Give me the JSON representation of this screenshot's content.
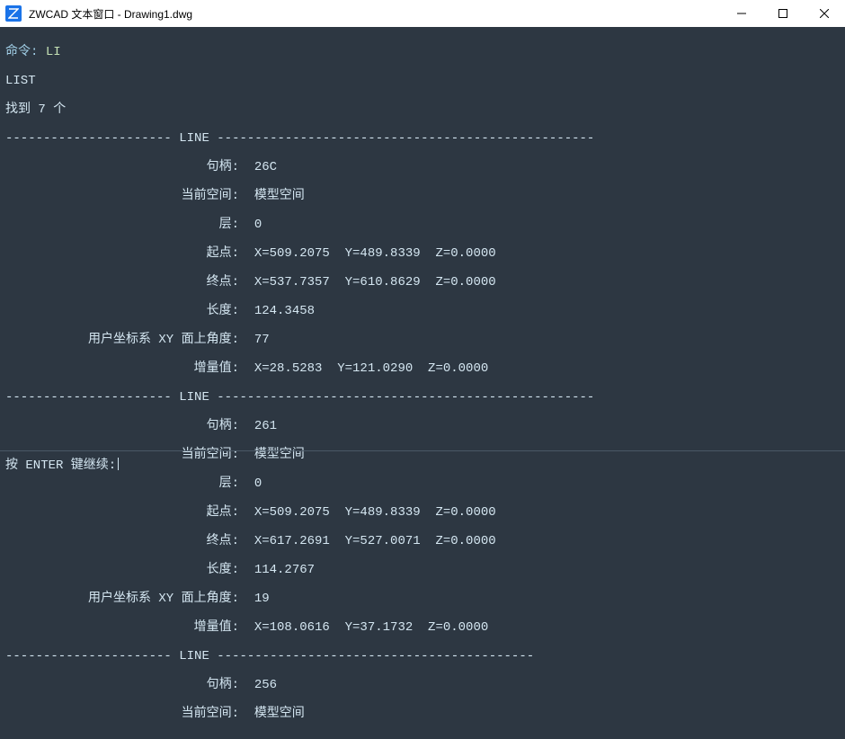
{
  "window": {
    "title": "ZWCAD 文本窗口 - Drawing1.dwg"
  },
  "console": {
    "command_prefix": "命令: ",
    "command_input": "LI",
    "command_name": "LIST",
    "found_line": "找到 7 个",
    "sep_label": " LINE ",
    "dash_left": "----------------------",
    "dash_right_long": "--------------------------------------------------",
    "dash_right_short": "------------------------------------------",
    "labels": {
      "handle": "句柄:",
      "current_space": "当前空间:",
      "layer": "层:",
      "start": "起点:",
      "end": "终点:",
      "length": "长度:",
      "ucs_angle": "用户坐标系 XY 面上角度:",
      "delta": "增量值:"
    },
    "entities": [
      {
        "handle": "26C",
        "space": "模型空间",
        "layer": "0",
        "start": "X=509.2075  Y=489.8339  Z=0.0000",
        "end": "X=537.7357  Y=610.8629  Z=0.0000",
        "length": "124.3458",
        "angle": "77",
        "delta": "X=28.5283  Y=121.0290  Z=0.0000"
      },
      {
        "handle": "261",
        "space": "模型空间",
        "layer": "0",
        "start": "X=509.2075  Y=489.8339  Z=0.0000",
        "end": "X=617.2691  Y=527.0071  Z=0.0000",
        "length": "114.2767",
        "angle": "19",
        "delta": "X=108.0616  Y=37.1732  Z=0.0000"
      },
      {
        "handle": "256",
        "space": "模型空间"
      }
    ]
  },
  "prompt": {
    "text": "按 ENTER 键继续:"
  }
}
